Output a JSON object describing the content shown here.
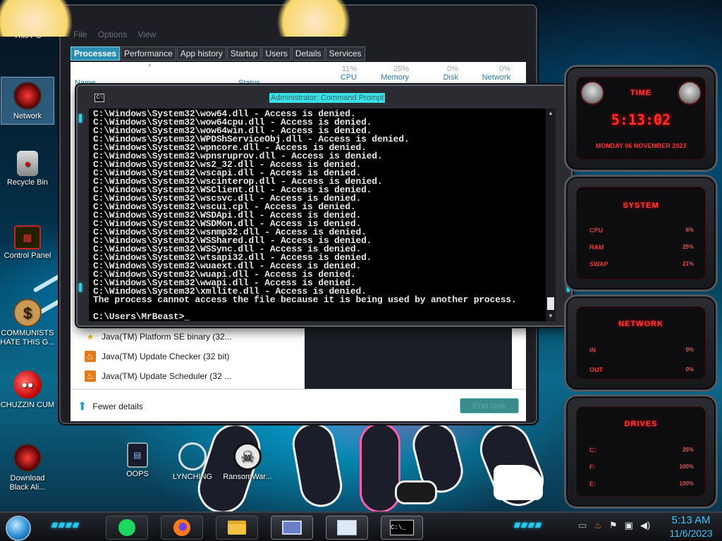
{
  "desktop": {
    "icons": [
      {
        "label": "This PC",
        "icon": "star-butterfly-icon"
      },
      {
        "label": "Network",
        "icon": "alien-head-icon"
      },
      {
        "label": "Recycle Bin",
        "icon": "recycle-bin-icon"
      },
      {
        "label": "Control Panel",
        "icon": "control-panel-icon"
      },
      {
        "label": "COMMUNISTS HATE THIS G...",
        "icon": "money-bag-icon"
      },
      {
        "label": "CHUZZIN CUM",
        "icon": "chuzzle-icon"
      },
      {
        "label": "Download Black Ali...",
        "icon": "alien-head-icon"
      },
      {
        "label": "OOPS",
        "icon": "document-icon"
      },
      {
        "label": "LYNCHING",
        "icon": "rope-icon"
      },
      {
        "label": "RansomWar...",
        "icon": "skull-icon"
      }
    ]
  },
  "task_manager": {
    "menu": [
      "File",
      "Options",
      "View"
    ],
    "tabs": [
      "Processes",
      "Performance",
      "App history",
      "Startup",
      "Users",
      "Details",
      "Services"
    ],
    "active_tab": "Processes",
    "columns": [
      {
        "name": "Name",
        "pct": ""
      },
      {
        "name": "Status",
        "pct": ""
      },
      {
        "name": "CPU",
        "pct": "11%"
      },
      {
        "name": "Memory",
        "pct": "25%"
      },
      {
        "name": "Disk",
        "pct": "0%"
      },
      {
        "name": "Network",
        "pct": "0%"
      }
    ],
    "rows": [
      {
        "name": "Java(TM) Platform SE binary (32...",
        "icon": "java-star-icon"
      },
      {
        "name": "Java(TM) Update Checker (32 bit)",
        "icon": "java-icon"
      },
      {
        "name": "Java(TM) Update Scheduler (32 ...",
        "icon": "java-icon"
      }
    ],
    "fewer_details": "Fewer details",
    "end_task": "End task"
  },
  "cmd": {
    "title": "Administrator: Command Prompt",
    "lines": [
      "C:\\Windows\\System32\\wow64.dll - Access is denied.",
      "C:\\Windows\\System32\\wow64cpu.dll - Access is denied.",
      "C:\\Windows\\System32\\wow64win.dll - Access is denied.",
      "C:\\Windows\\System32\\WPDShServiceObj.dll - Access is denied.",
      "C:\\Windows\\System32\\wpncore.dll - Access is denied.",
      "C:\\Windows\\System32\\wpnsruprov.dll - Access is denied.",
      "C:\\Windows\\System32\\ws2_32.dll - Access is denied.",
      "C:\\Windows\\System32\\wscapi.dll - Access is denied.",
      "C:\\Windows\\System32\\wscinterop.dll - Access is denied.",
      "C:\\Windows\\System32\\WSClient.dll - Access is denied.",
      "C:\\Windows\\System32\\wscsvc.dll - Access is denied.",
      "C:\\Windows\\System32\\wscui.cpl - Access is denied.",
      "C:\\Windows\\System32\\WSDApi.dll - Access is denied.",
      "C:\\Windows\\System32\\WSDMon.dll - Access is denied.",
      "C:\\Windows\\System32\\wsnmp32.dll - Access is denied.",
      "C:\\Windows\\System32\\WSShared.dll - Access is denied.",
      "C:\\Windows\\System32\\WSSync.dll - Access is denied.",
      "C:\\Windows\\System32\\wtsapi32.dll - Access is denied.",
      "C:\\Windows\\System32\\wuaext.dll - Access is denied.",
      "C:\\Windows\\System32\\wuapi.dll - Access is denied.",
      "C:\\Windows\\System32\\wwapi.dll - Access is denied.",
      "C:\\Windows\\System32\\xmllite.dll - Access is denied.",
      "The process cannot access the file because it is being used by another process.",
      "",
      "C:\\Users\\MrBeast>_"
    ]
  },
  "gadgets": {
    "time": {
      "title": "TIME",
      "clock": "5:13:02",
      "date": "MONDAY 06 NOVEMBER 2023"
    },
    "system": {
      "title": "SYSTEM",
      "rows": [
        {
          "label": "CPU",
          "value": "6%"
        },
        {
          "label": "RAM",
          "value": "25%"
        },
        {
          "label": "SWAP",
          "value": "21%"
        }
      ]
    },
    "network": {
      "title": "NETWORK",
      "rows": [
        {
          "label": "IN",
          "value": "0%"
        },
        {
          "label": "OUT",
          "value": "0%"
        }
      ]
    },
    "drives": {
      "title": "DRIVES",
      "rows": [
        {
          "label": "C:",
          "value": "26%"
        },
        {
          "label": "F:",
          "value": "100%"
        },
        {
          "label": "E:",
          "value": "100%"
        }
      ]
    }
  },
  "taskbar": {
    "pinned": [
      {
        "name": "spotify-icon",
        "color": "#1ed760"
      },
      {
        "name": "firefox-icon",
        "color": "#ff7a1a"
      },
      {
        "name": "file-explorer-icon",
        "color": "#f5c242"
      },
      {
        "name": "control-panel-icon",
        "color": "#6b7fc9"
      },
      {
        "name": "task-manager-icon",
        "color": "#9ab7d8"
      },
      {
        "name": "command-prompt-icon",
        "color": "#000000"
      }
    ],
    "time": "5:13 AM",
    "date": "11/6/2023"
  },
  "colors": {
    "accent": "#28c9ee",
    "alien_red": "#ff2e2e",
    "tm_header": "#2a7fae"
  }
}
